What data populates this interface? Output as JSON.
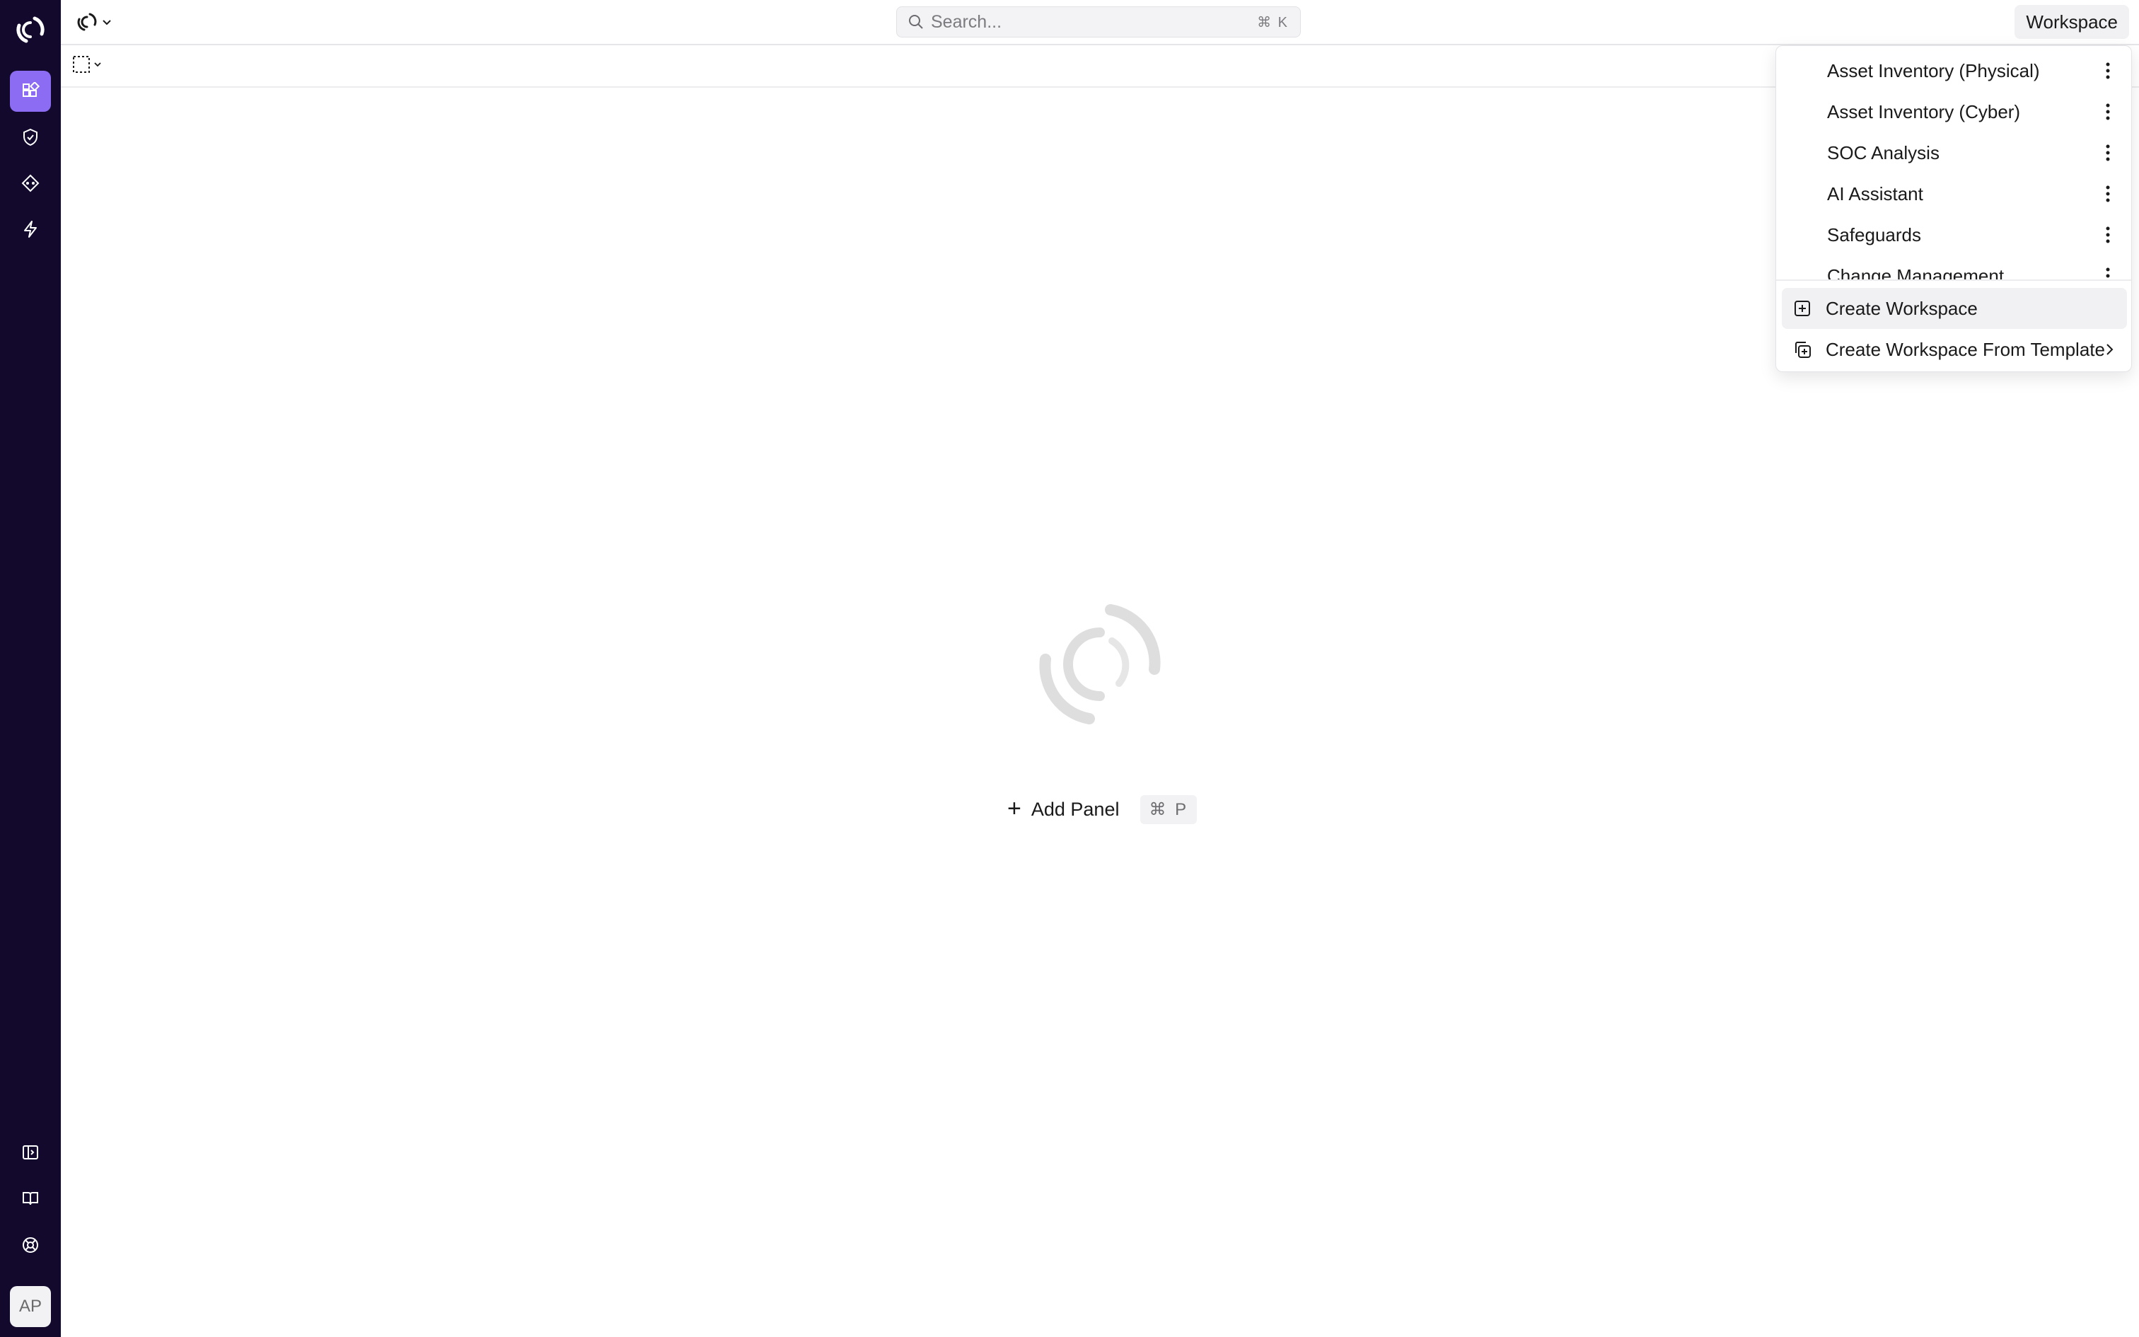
{
  "app": {
    "brand_color": "#8b6cf2",
    "rail_color": "#12092d"
  },
  "rail": {
    "nav": [
      {
        "icon": "dashboard-icon",
        "active": true
      },
      {
        "icon": "shield-check-icon",
        "active": false
      },
      {
        "icon": "diamond-nodes-icon",
        "active": false
      },
      {
        "icon": "lightning-icon",
        "active": false
      }
    ],
    "bottom": [
      {
        "icon": "sidebar-toggle-icon"
      },
      {
        "icon": "book-icon"
      },
      {
        "icon": "help-lifebuoy-icon"
      }
    ],
    "avatar_initials": "AP"
  },
  "topbar": {
    "search_placeholder": "Search...",
    "search_shortcut": "⌘ K",
    "workspace_button": "Workspace"
  },
  "empty_state": {
    "add_panel_label": "Add Panel",
    "add_panel_shortcut": "⌘ P"
  },
  "workspace_menu": {
    "items": [
      "Asset Inventory (Physical)",
      "Asset Inventory (Cyber)",
      "SOC Analysis",
      "AI Assistant",
      "Safeguards",
      "Change Management"
    ],
    "actions": {
      "create": "Create Workspace",
      "create_from_template": "Create Workspace From Template"
    }
  }
}
